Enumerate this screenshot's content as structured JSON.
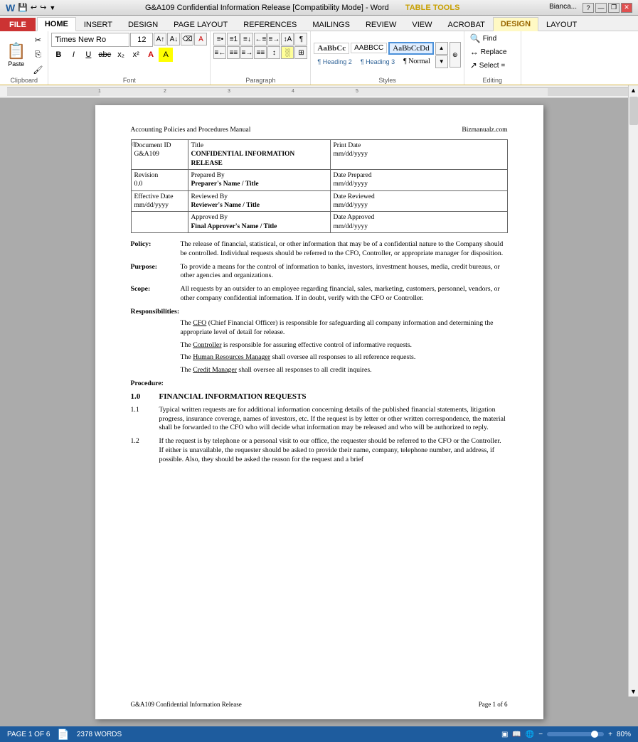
{
  "titlebar": {
    "title": "G&A109 Confidential Information Release [Compatibility Mode] - Word",
    "tools_label": "TABLE TOOLS",
    "help_btn": "?",
    "minimize": "—",
    "restore": "❐",
    "close": "✕",
    "user": "Bianca..."
  },
  "ribbon_tabs": [
    {
      "id": "file",
      "label": "FILE",
      "type": "file"
    },
    {
      "id": "home",
      "label": "HOME",
      "type": "active"
    },
    {
      "id": "insert",
      "label": "INSERT",
      "type": "normal"
    },
    {
      "id": "design",
      "label": "DESIGN",
      "type": "normal"
    },
    {
      "id": "page_layout",
      "label": "PAGE LAYOUT",
      "type": "normal"
    },
    {
      "id": "references",
      "label": "REFERENCES",
      "type": "normal"
    },
    {
      "id": "mailings",
      "label": "MAILINGS",
      "type": "normal"
    },
    {
      "id": "review",
      "label": "REVIEW",
      "type": "normal"
    },
    {
      "id": "view",
      "label": "VIEW",
      "type": "normal"
    },
    {
      "id": "acrobat",
      "label": "ACROBAT",
      "type": "normal"
    },
    {
      "id": "design2",
      "label": "DESIGN",
      "type": "yellow"
    },
    {
      "id": "layout",
      "label": "LAYOUT",
      "type": "normal"
    }
  ],
  "toolbar": {
    "paste_label": "Paste",
    "font_name": "Times New Ro",
    "font_size": "12",
    "bold": "B",
    "italic": "I",
    "underline": "U",
    "find_label": "Find",
    "replace_label": "Replace",
    "select_label": "Select ="
  },
  "styles": {
    "s1": "AaBbCc",
    "s2": "AABBCC",
    "s3": "AaBbCcDd",
    "heading2": "¶ Heading 2",
    "heading3": "¶ Heading 3",
    "normal": "¶ Normal"
  },
  "document": {
    "header_left": "Accounting Policies and Procedures Manual",
    "header_right": "Bizmanualz.com",
    "doc_id_label": "Document ID",
    "doc_id_value": "G&A109",
    "title_label": "Title",
    "title_value": "CONFIDENTIAL INFORMATION RELEASE",
    "print_date_label": "Print Date",
    "print_date_value": "mm/dd/yyyy",
    "revision_label": "Revision",
    "revision_value": "0.0",
    "prepared_by_label": "Prepared By",
    "prepared_by_value": "Preparer's Name / Title",
    "date_prepared_label": "Date Prepared",
    "date_prepared_value": "mm/dd/yyyy",
    "effective_date_label": "Effective Date",
    "effective_date_value": "mm/dd/yyyy",
    "reviewed_by_label": "Reviewed By",
    "reviewed_by_value": "Reviewer's Name / Title",
    "date_reviewed_label": "Date Reviewed",
    "date_reviewed_value": "mm/dd/yyyy",
    "approved_by_label": "Approved By",
    "approved_by_value": "Final Approver's Name / Title",
    "date_approved_label": "Date Approved",
    "date_approved_value": "mm/dd/yyyy",
    "policy_label": "Policy:",
    "policy_text": "The release of financial, statistical, or other information that may be of a confidential nature to the Company should be controlled.  Individual requests should be referred to the CFO, Controller, or appropriate manager for disposition.",
    "purpose_label": "Purpose:",
    "purpose_text": "To provide a means for the control of information to banks, investors, investment houses, media, credit bureaus, or other agencies and organizations.",
    "scope_label": "Scope:",
    "scope_text": "All requests by an outsider to an employee regarding financial, sales, marketing, customers, personnel, vendors, or other company confidential information.  If in doubt, verify with the CFO or Controller.",
    "responsibilities_label": "Responsibilities:",
    "resp1": "The CFO (Chief Financial Officer) is responsible for safeguarding all company information and determining the appropriate level of detail for release.",
    "resp1_underline": "CFO",
    "resp2": "The Controller is responsible for assuring effective control of informative requests.",
    "resp2_underline": "Controller",
    "resp3": "The Human Resources Manager shall oversee all responses to all reference requests.",
    "resp3_underline": "Human Resources Manager",
    "resp4": "The Credit Manager shall oversee all responses to all credit inquires.",
    "resp4_underline": "Credit Manager",
    "procedure_label": "Procedure:",
    "section1_num": "1.0",
    "section1_title": "FINANCIAL INFORMATION REQUESTS",
    "section11_num": "1.1",
    "section11_text": "Typical written requests are for additional information concerning details of the published financial statements, litigation progress, insurance coverage, names of investors, etc.  If the request is by letter or other written correspondence, the material shall be forwarded to the CFO who will decide what information may be released and who will be authorized to reply.",
    "section12_num": "1.2",
    "section12_text": "If the request is by telephone or a personal visit to our office, the requester should be referred to the CFO or the Controller.  If either is unavailable, the requester should be asked to provide their name, company, telephone number, and address, if possible.  Also, they should be asked the reason for the request and a brief"
  },
  "page_footer_left": "G&A109 Confidential Information Release",
  "page_footer_right": "Page 1 of 6",
  "status_bar": {
    "page": "PAGE 1 OF 6",
    "words": "2378 WORDS",
    "zoom": "80%"
  }
}
